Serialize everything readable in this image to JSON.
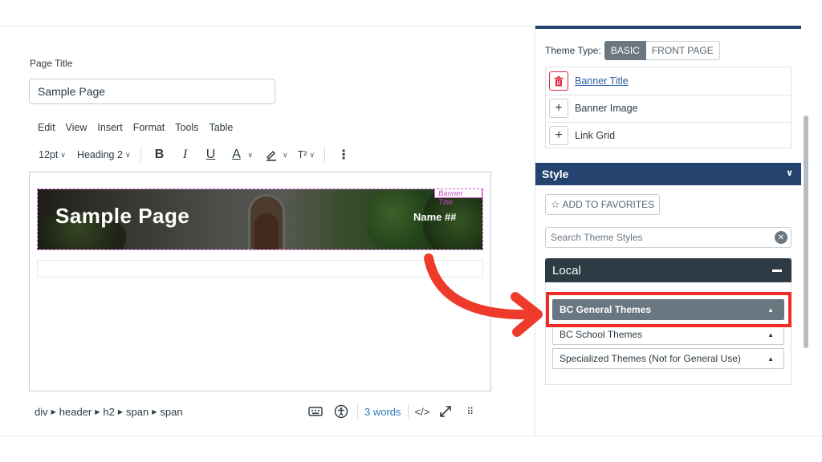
{
  "editor": {
    "page_title_label": "Page Title",
    "page_title_value": "Sample Page",
    "menu": [
      "Edit",
      "View",
      "Insert",
      "Format",
      "Tools",
      "Table"
    ],
    "toolbar": {
      "font_size": "12pt",
      "block_format": "Heading 2",
      "bold": "B",
      "italic": "I",
      "underline": "U",
      "text_color": "A",
      "superscript": "T²",
      "more": "⋮"
    },
    "banner": {
      "tag": "Banner Title",
      "title": "Sample Page",
      "name": "Name ##"
    },
    "status": {
      "path": [
        "div",
        "header",
        "h2",
        "span",
        "span"
      ],
      "word_count": "3 words",
      "html_toggle": "</>"
    }
  },
  "sidebar": {
    "theme_type_label": "Theme Type:",
    "theme_types": [
      "BASIC",
      "FRONT PAGE"
    ],
    "elements": [
      {
        "label": "Banner Title",
        "action": "delete"
      },
      {
        "label": "Banner Image",
        "action": "add"
      },
      {
        "label": "Link Grid",
        "action": "add"
      }
    ],
    "style_header": "Style",
    "add_favorites": "ADD TO FAVORITES",
    "search_placeholder": "Search Theme Styles",
    "local_header": "Local",
    "accordions": [
      {
        "label": "BC General Themes",
        "active": true
      },
      {
        "label": "BC School Themes",
        "active": false
      },
      {
        "label": "Specialized Themes (Not for General Use)",
        "active": false
      }
    ]
  },
  "colors": {
    "navy": "#24436e",
    "highlight_red": "#ee2e24",
    "banner_tag_pink": "#c24bc0",
    "delete_red": "#e0263a"
  }
}
